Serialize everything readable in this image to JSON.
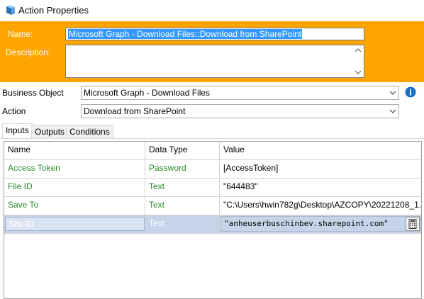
{
  "window": {
    "title": "Action Properties",
    "title_icon": "blueprism-action-icon"
  },
  "header": {
    "name_label": "Name:",
    "name_value": "Microsoft Graph - Download Files::Download from SharePoint",
    "description_label": "Description:",
    "description_value": "",
    "background_color": "#ffa500"
  },
  "form": {
    "business_object_label": "Business Object",
    "business_object_value": "Microsoft Graph - Download Files",
    "action_label": "Action",
    "action_value": "Download from SharePoint",
    "info_icon": "info-icon"
  },
  "tabs": [
    {
      "label": "Inputs",
      "active": true
    },
    {
      "label": "Outputs",
      "active": false
    },
    {
      "label": "Conditions",
      "active": false
    }
  ],
  "grid": {
    "headers": [
      "Name",
      "Data Type",
      "Value"
    ],
    "rows": [
      {
        "name": "Access Token",
        "type": "Password",
        "value": "[AccessToken]"
      },
      {
        "name": "File ID",
        "type": "Text",
        "value": "\"644483\""
      },
      {
        "name": "Save To",
        "type": "Text",
        "value": "\"C:\\Users\\hwin782g\\Desktop\\AZCOPY\\20221208_1..."
      },
      {
        "name": "Site ID",
        "type": "Text",
        "value": "\"anheuserbuschinbev.sharepoint.com\"",
        "selected": true
      }
    ]
  }
}
